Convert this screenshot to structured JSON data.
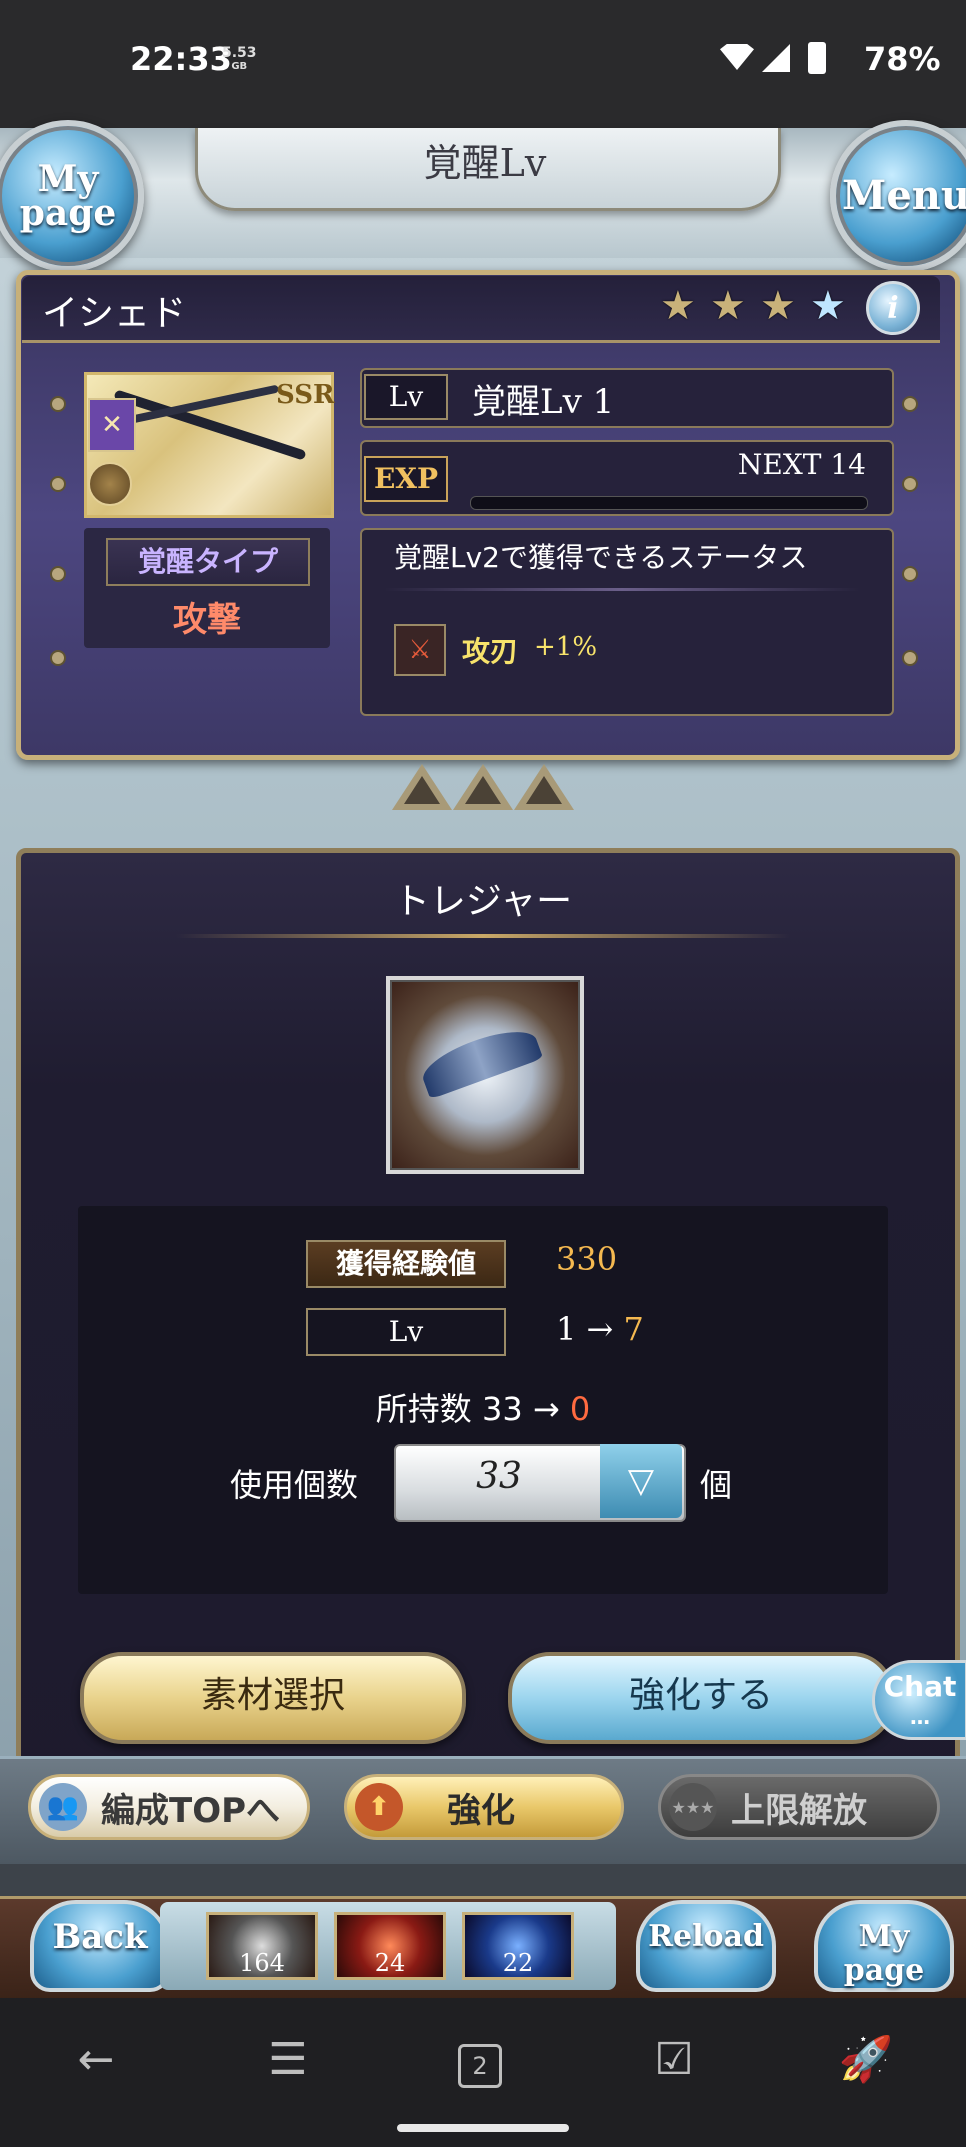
{
  "status_bar": {
    "time": "22:33",
    "speed_value": "5.53",
    "speed_unit": "GB",
    "battery": "78%"
  },
  "header": {
    "title": "覚醒Lv",
    "left_button": "My page",
    "right_button": "Menu"
  },
  "character": {
    "name": "イシェド",
    "stars_filled": 3,
    "stars_blue": 1,
    "rarity_badge": "SSR",
    "awaken_type_label": "覚醒タイプ",
    "awaken_type_value": "攻撃",
    "lv_tag": "Lv",
    "lv_text": "覚醒Lv 1",
    "exp_tag": "EXP",
    "exp_next": "NEXT 14",
    "exp_progress": 0,
    "stat_title": "覚醒Lv2で獲得できるステータス",
    "stat_name": "攻刃",
    "stat_value": "+1%"
  },
  "treasure": {
    "title": "トレジャー",
    "exp_gain_label": "獲得経験値",
    "exp_gain_value": "330",
    "lv_label": "Lv",
    "lv_from": "1",
    "lv_arrow": "→",
    "lv_to": "7",
    "own_label": "所持数",
    "own_from": "33",
    "own_arrow": "→",
    "own_to": "0",
    "use_label": "使用個数",
    "use_value": "33",
    "use_unit": "個"
  },
  "actions": {
    "select_material": "素材選択",
    "enhance": "強化する",
    "chat": "Chat"
  },
  "tabs": {
    "party": "編成TOPへ",
    "upgrade": "強化",
    "limit_break": "上限解放"
  },
  "bottom_bar": {
    "back": "Back",
    "reload": "Reload",
    "mypage": "My page",
    "items": [
      "164",
      "24",
      "22"
    ]
  },
  "android_nav": {
    "tab_count": "2"
  }
}
